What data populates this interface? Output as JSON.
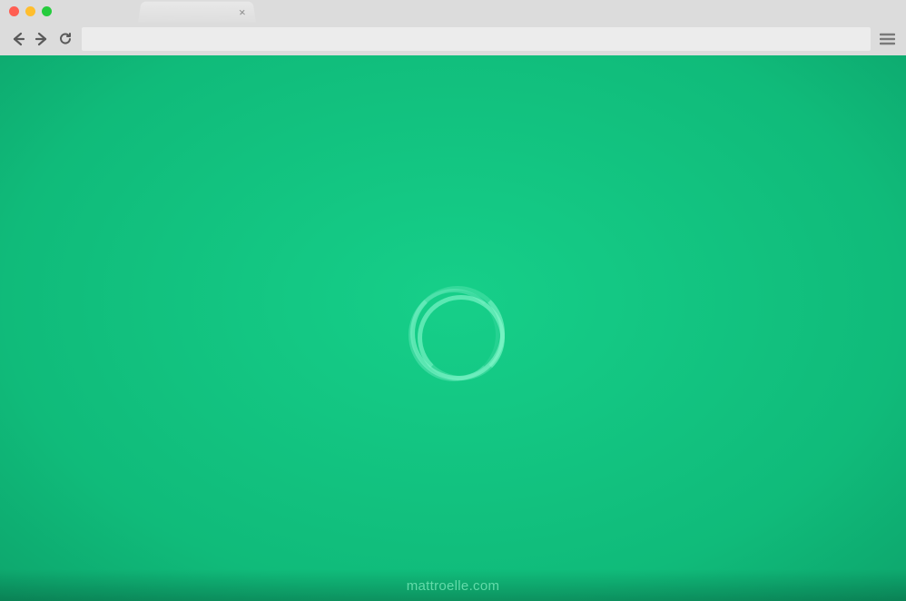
{
  "browser": {
    "tab": {
      "close_glyph": "×"
    },
    "address_value": ""
  },
  "page": {
    "attribution": "mattroelle.com"
  }
}
